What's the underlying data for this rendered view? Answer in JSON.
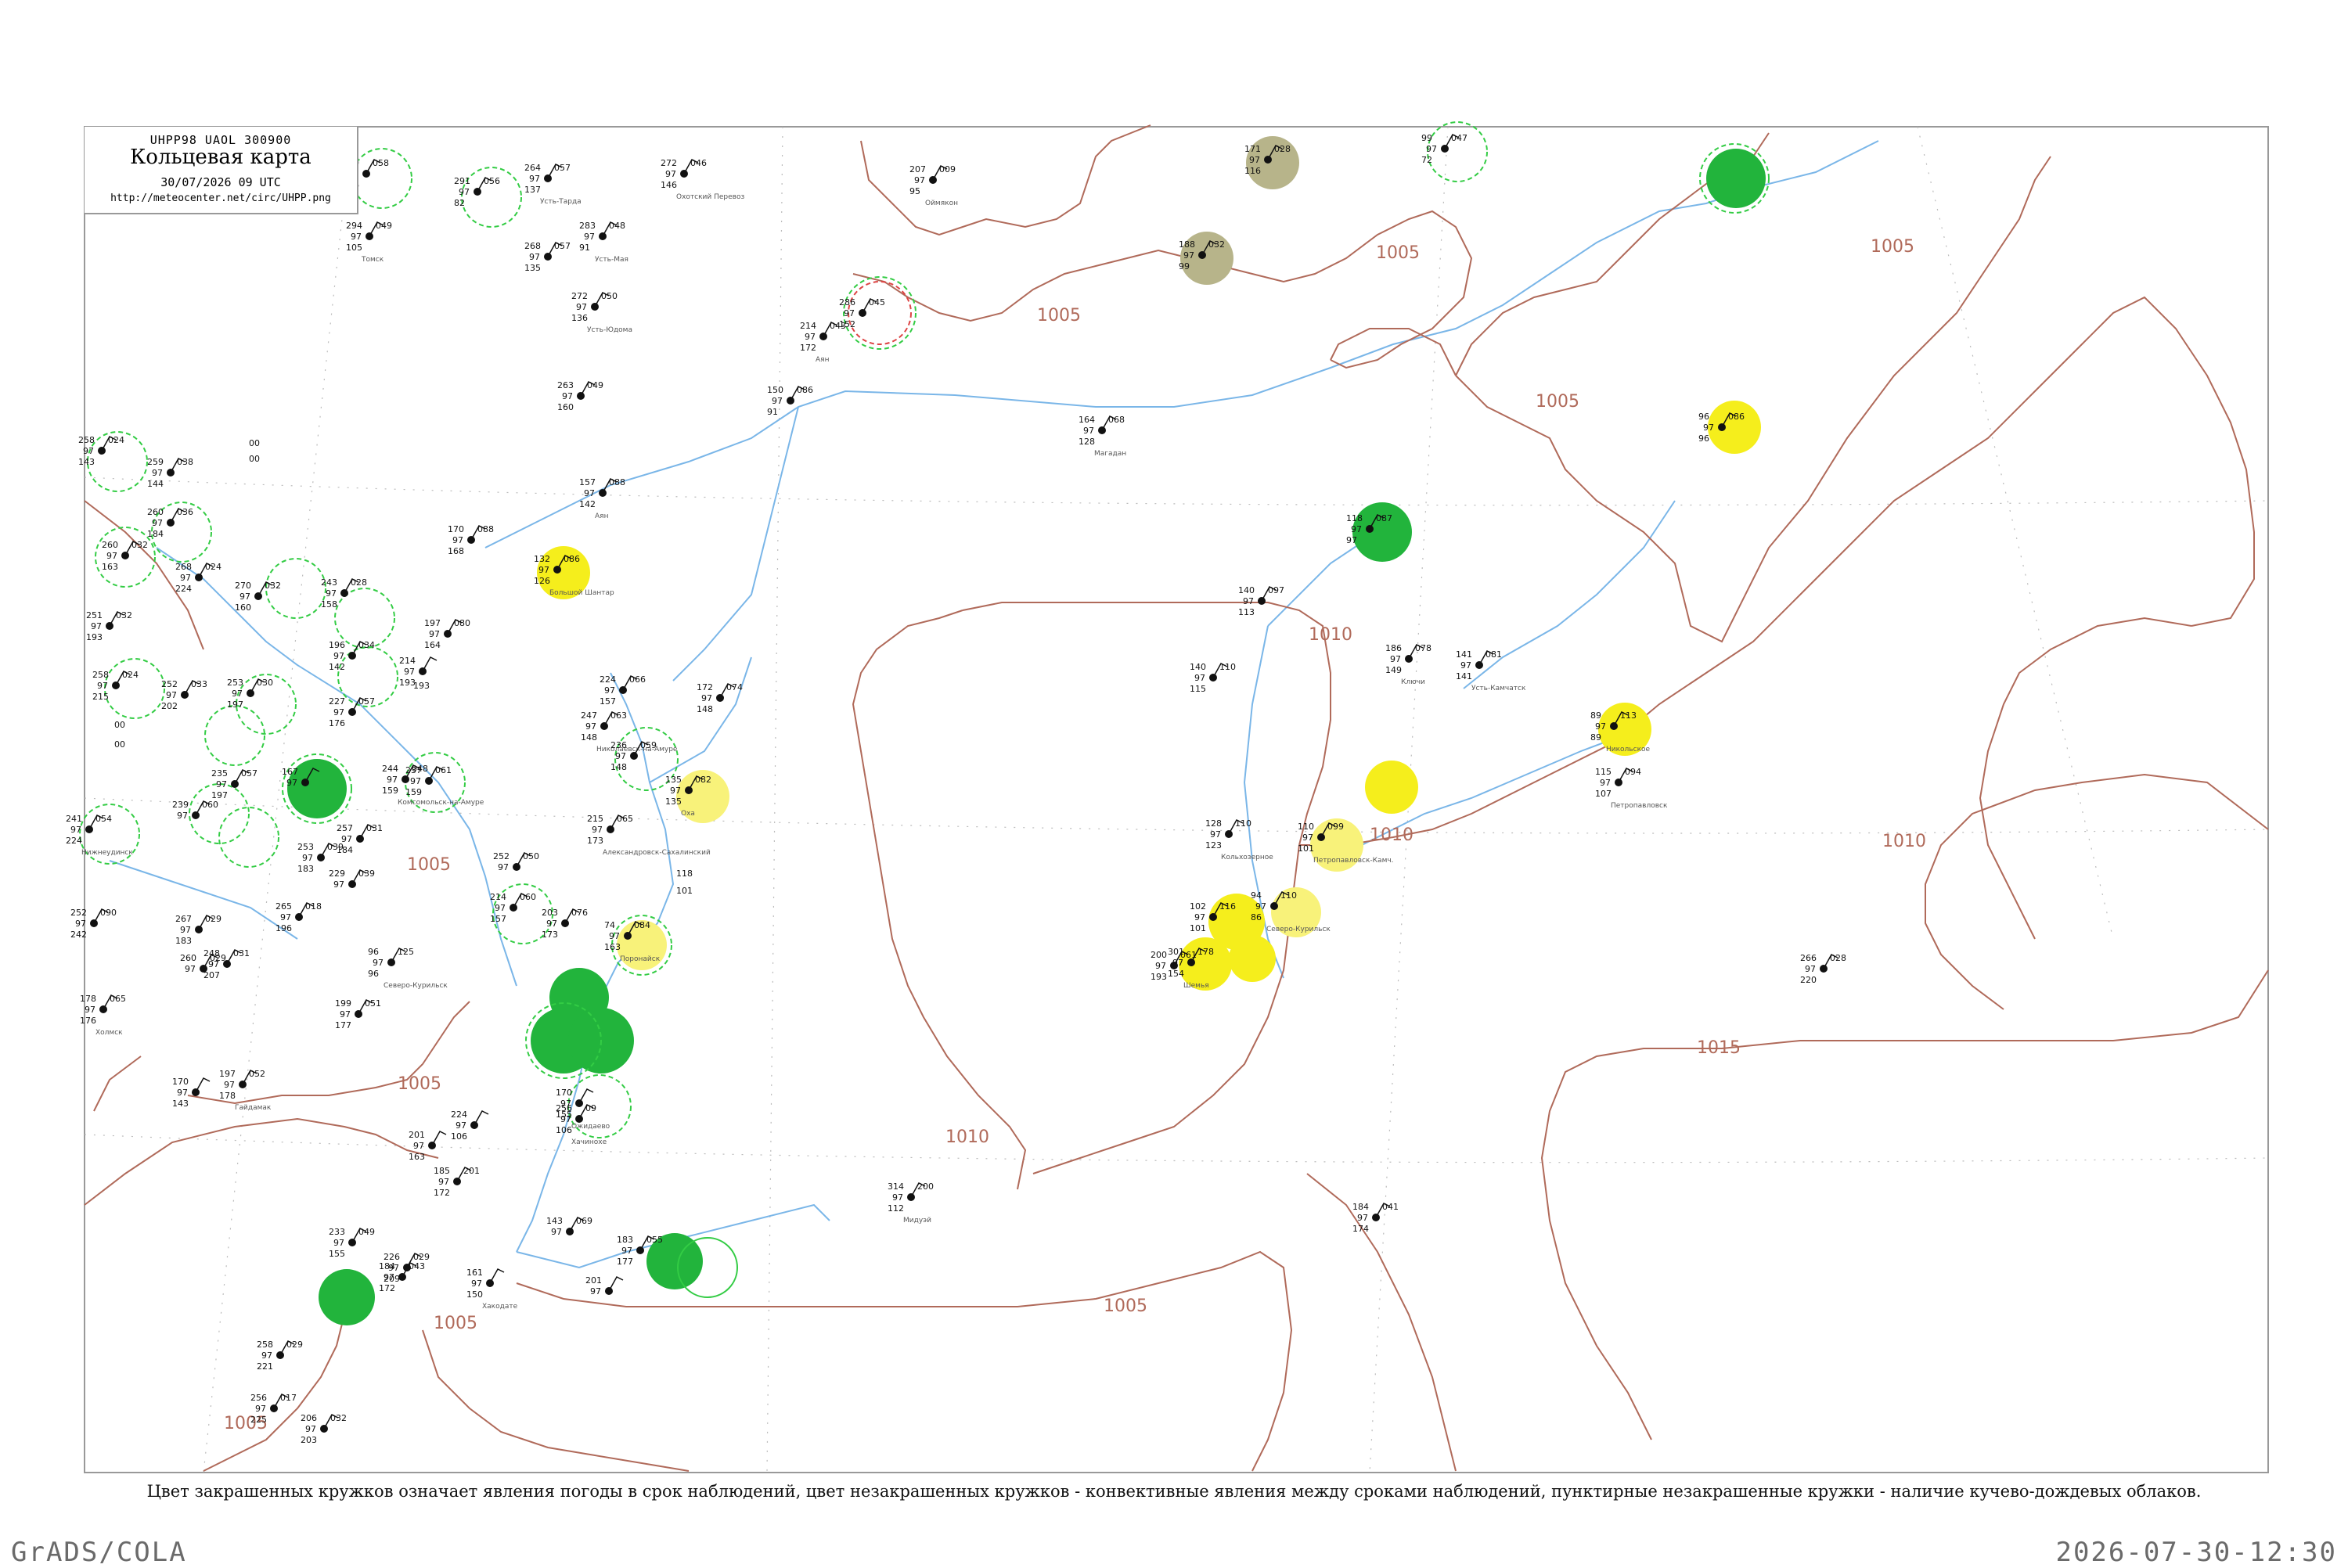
{
  "legend": {
    "code": "UHPP98 UAOL 300900",
    "title": "Кольцевая карта",
    "date": "30/07/2026 09 UTC",
    "url": "http://meteocenter.net/circ/UHPP.png"
  },
  "caption": "Цвет закрашенных кружков означает явления погоды в срок наблюдений, цвет незакрашенных кружков - конвективные явления между сроками наблюдений, пунктирные незакрашенные кружки - наличие кучево-дождевых облаков.",
  "footer": {
    "left": "GrADS/COLA",
    "right": "2026-07-30-12:30"
  },
  "colors": {
    "isobar": "#b06a5a",
    "river": "#7ab6e8",
    "frame": "#999999",
    "green_fill": "#22b43c",
    "yellow_fill": "#f5ee1c",
    "light_yellow_fill": "#f8f27a",
    "olive_fill": "#b7b48a",
    "green_dashed": "#33cc44",
    "red_dashed": "#dd4444"
  },
  "isobar_labels": [
    {
      "text": "1005"
    },
    {
      "text": "1005"
    },
    {
      "text": "1005"
    },
    {
      "text": "1005"
    },
    {
      "text": "1010"
    },
    {
      "text": "1010"
    },
    {
      "text": "1010"
    },
    {
      "text": "1005"
    },
    {
      "text": "1005"
    },
    {
      "text": "1010"
    },
    {
      "text": "1015"
    },
    {
      "text": "1005"
    },
    {
      "text": "1005"
    },
    {
      "text": "1005"
    }
  ],
  "stations": [
    {
      "t": "280",
      "p": "058",
      "s": "146",
      "name": ""
    },
    {
      "t": "291",
      "p": "056",
      "s": "82",
      "name": ""
    },
    {
      "t": "264",
      "p": "057",
      "s": "137",
      "name": "Усть-Тарда"
    },
    {
      "t": "272",
      "p": "046",
      "s": "146",
      "name": "Охотский Перевоз"
    },
    {
      "t": "207",
      "p": "009",
      "s": "95",
      "name": "Оймякон"
    },
    {
      "t": "171",
      "p": "028",
      "s": "116",
      "name": ""
    },
    {
      "t": "99",
      "p": "047",
      "s": "72",
      "name": ""
    },
    {
      "t": "188",
      "p": "032",
      "s": "99",
      "name": ""
    },
    {
      "t": "294",
      "p": "049",
      "s": "105",
      "name": "Томск"
    },
    {
      "t": "268",
      "p": "057",
      "s": "135",
      "name": ""
    },
    {
      "t": "283",
      "p": "048",
      "s": "91",
      "name": "Усть-Мая"
    },
    {
      "t": "272",
      "p": "050",
      "s": "136",
      "name": "Усть-Юдома"
    },
    {
      "t": "286",
      "p": "045",
      "s": "152",
      "name": ""
    },
    {
      "t": "214",
      "p": "043",
      "s": "172",
      "name": "Аян"
    },
    {
      "t": "263",
      "p": "049",
      "s": "160",
      "name": ""
    },
    {
      "t": "150",
      "p": "086",
      "s": "91",
      "name": ""
    },
    {
      "t": "164",
      "p": "068",
      "s": "128",
      "name": "Магадан"
    },
    {
      "t": "96",
      "p": "086",
      "s": "96",
      "name": ""
    },
    {
      "t": "118",
      "p": "087",
      "s": "97",
      "name": ""
    },
    {
      "t": "258",
      "p": "024",
      "s": "143",
      "name": ""
    },
    {
      "t": "259",
      "p": "038",
      "s": "144",
      "name": ""
    },
    {
      "t": "157",
      "p": "088",
      "s": "142",
      "name": "Аян"
    },
    {
      "t": "170",
      "p": "088",
      "s": "168",
      "name": ""
    },
    {
      "t": "132",
      "p": "086",
      "s": "126",
      "name": "Большой Шантар"
    },
    {
      "t": "260",
      "p": "036",
      "s": "184",
      "name": ""
    },
    {
      "t": "268",
      "p": "024",
      "s": "224",
      "name": ""
    },
    {
      "t": "270",
      "p": "032",
      "s": "160",
      "name": ""
    },
    {
      "t": "243",
      "p": "028",
      "s": "158",
      "name": ""
    },
    {
      "t": "260",
      "p": "032",
      "s": "163",
      "name": ""
    },
    {
      "t": "140",
      "p": "097",
      "s": "113",
      "name": ""
    },
    {
      "t": "251",
      "p": "032",
      "s": "193",
      "name": ""
    },
    {
      "t": "197",
      "p": "080",
      "s": "164",
      "name": ""
    },
    {
      "t": "196",
      "p": "034",
      "s": "142",
      "name": ""
    },
    {
      "t": "186",
      "p": "078",
      "s": "149",
      "name": "Ключи"
    },
    {
      "t": "141",
      "p": "081",
      "s": "141",
      "name": "Усть-Камчатск"
    },
    {
      "t": "140",
      "p": "110",
      "s": "115",
      "name": ""
    },
    {
      "t": "214",
      "p": "",
      "s": "193",
      "name": ""
    },
    {
      "t": "224",
      "p": "066",
      "s": "157",
      "name": ""
    },
    {
      "t": "172",
      "p": "074",
      "s": "148",
      "name": ""
    },
    {
      "t": "258",
      "p": "024",
      "s": "215",
      "name": ""
    },
    {
      "t": "253",
      "p": "030",
      "s": "197",
      "name": ""
    },
    {
      "t": "252",
      "p": "033",
      "s": "202",
      "name": ""
    },
    {
      "t": "227",
      "p": "057",
      "s": "176",
      "name": ""
    },
    {
      "t": "247",
      "p": "063",
      "s": "148",
      "name": "Николаевск-на-Амуре"
    },
    {
      "t": "89",
      "p": "113",
      "s": "89",
      "name": "Никольское"
    },
    {
      "t": "236",
      "p": "059",
      "s": "148",
      "name": ""
    },
    {
      "t": "237",
      "p": "061",
      "s": "159",
      "name": ""
    },
    {
      "t": "244",
      "p": "048",
      "s": "159",
      "name": "Комсомольск-на-Амуре"
    },
    {
      "t": "115",
      "p": "094",
      "s": "107",
      "name": "Петропавловск"
    },
    {
      "t": "135",
      "p": "082",
      "s": "135",
      "name": "Оха"
    },
    {
      "t": "235",
      "p": "057",
      "s": "197",
      "name": ""
    },
    {
      "t": "167",
      "p": "",
      "s": "",
      "name": ""
    },
    {
      "t": "241",
      "p": "054",
      "s": "224",
      "name": "Нижнеудинск"
    },
    {
      "t": "239",
      "p": "060",
      "s": "",
      "name": ""
    },
    {
      "t": "257",
      "p": "031",
      "s": "184",
      "name": ""
    },
    {
      "t": "215",
      "p": "065",
      "s": "173",
      "name": "Александровск-Сахалинский"
    },
    {
      "t": "128",
      "p": "110",
      "s": "123",
      "name": "Кольхозерное"
    },
    {
      "t": "110",
      "p": "099",
      "s": "101",
      "name": "Петропавловск-Камч."
    },
    {
      "t": "253",
      "p": "039",
      "s": "183",
      "name": ""
    },
    {
      "t": "252",
      "p": "050",
      "s": "",
      "name": ""
    },
    {
      "t": "229",
      "p": "039",
      "s": "",
      "name": ""
    },
    {
      "t": "252",
      "p": "090",
      "s": "242",
      "name": ""
    },
    {
      "t": "265",
      "p": "018",
      "s": "196",
      "name": ""
    },
    {
      "t": "267",
      "p": "029",
      "s": "183",
      "name": ""
    },
    {
      "t": "214",
      "p": "060",
      "s": "157",
      "name": ""
    },
    {
      "t": "203",
      "p": "076",
      "s": "173",
      "name": ""
    },
    {
      "t": "74",
      "p": "084",
      "s": "163",
      "name": "Поронайск"
    },
    {
      "t": "94",
      "p": "110",
      "s": "86",
      "name": "Северо-Курильск"
    },
    {
      "t": "102",
      "p": "116",
      "s": "101",
      "name": ""
    },
    {
      "t": "260",
      "p": "029",
      "s": "",
      "name": ""
    },
    {
      "t": "248",
      "p": "031",
      "s": "207",
      "name": ""
    },
    {
      "t": "200",
      "p": "061",
      "s": "193",
      "name": ""
    },
    {
      "t": "96",
      "p": "125",
      "s": "96",
      "name": "Северо-Курильск"
    },
    {
      "t": "301",
      "p": "178",
      "s": "154",
      "name": "Шемья"
    },
    {
      "t": "266",
      "p": "028",
      "s": "220",
      "name": ""
    },
    {
      "t": "178",
      "p": "065",
      "s": "176",
      "name": "Холмск"
    },
    {
      "t": "199",
      "p": "051",
      "s": "177",
      "name": ""
    },
    {
      "t": "197",
      "p": "052",
      "s": "178",
      "name": "Гайдамак"
    },
    {
      "t": "170",
      "p": "",
      "s": "143",
      "name": ""
    },
    {
      "t": "170",
      "p": "",
      "s": "155",
      "name": "Ожидаево"
    },
    {
      "t": "256",
      "p": "09",
      "s": "106",
      "name": "Хачинохе"
    },
    {
      "t": "314",
      "p": "200",
      "s": "112",
      "name": "Мидуэй"
    },
    {
      "t": "184",
      "p": "041",
      "s": "174",
      "name": ""
    },
    {
      "t": "224",
      "p": "",
      "s": "106",
      "name": ""
    },
    {
      "t": "201",
      "p": "",
      "s": "163",
      "name": ""
    },
    {
      "t": "185",
      "p": "201",
      "s": "172",
      "name": ""
    },
    {
      "t": "233",
      "p": "049",
      "s": "155",
      "name": ""
    },
    {
      "t": "143",
      "p": "069",
      "s": "",
      "name": ""
    },
    {
      "t": "183",
      "p": "055",
      "s": "177",
      "name": ""
    },
    {
      "t": "161",
      "p": "",
      "s": "150",
      "name": "Хакодате"
    },
    {
      "t": "201",
      "p": "",
      "s": "",
      "name": ""
    },
    {
      "t": "184",
      "p": "043",
      "s": "172",
      "name": ""
    },
    {
      "t": "226",
      "p": "029",
      "s": "209",
      "name": ""
    },
    {
      "t": "258",
      "p": "029",
      "s": "221",
      "name": ""
    },
    {
      "t": "256",
      "p": "017",
      "s": "225",
      "name": ""
    },
    {
      "t": "206",
      "p": "032",
      "s": "203",
      "name": ""
    }
  ],
  "loose_numbers": [
    {
      "text": "00"
    },
    {
      "text": "00"
    },
    {
      "text": "00"
    },
    {
      "text": "00"
    },
    {
      "text": "118"
    },
    {
      "text": "101"
    },
    {
      "text": "193"
    }
  ]
}
